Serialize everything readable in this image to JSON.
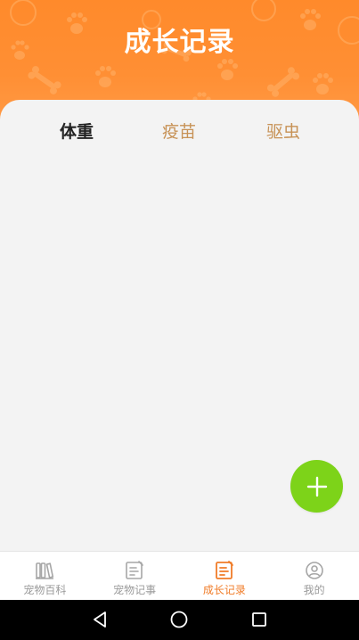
{
  "header": {
    "title": "成长记录",
    "bg_color": "#ff8a2b"
  },
  "tabs": [
    {
      "label": "体重",
      "active": true
    },
    {
      "label": "疫苗",
      "active": false
    },
    {
      "label": "驱虫",
      "active": false
    }
  ],
  "fab": {
    "icon": "plus-icon",
    "color": "#7dd319"
  },
  "bottom_nav": [
    {
      "label": "宠物百科",
      "icon": "books-icon",
      "active": false
    },
    {
      "label": "宠物记事",
      "icon": "notepad-icon",
      "active": false
    },
    {
      "label": "成长记录",
      "icon": "record-icon",
      "active": true
    },
    {
      "label": "我的",
      "icon": "user-icon",
      "active": false
    }
  ],
  "colors": {
    "accent": "#f07c28",
    "tab_inactive": "#c79256",
    "nav_inactive": "#9a9a9a"
  },
  "system_bar": {
    "buttons": [
      "back-icon",
      "home-icon",
      "recent-apps-icon"
    ]
  }
}
